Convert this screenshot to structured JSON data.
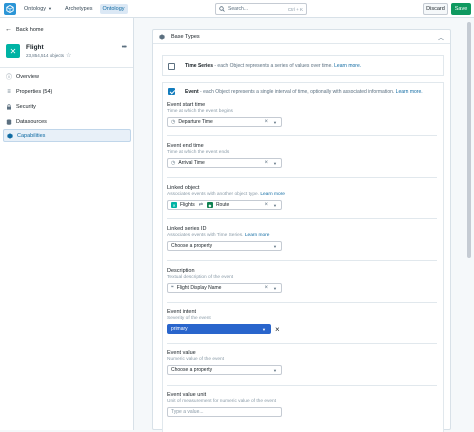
{
  "topbar": {
    "app_label": "Ontology",
    "tabs": [
      "Archetypes",
      "Ontology"
    ],
    "search_placeholder": "Search...",
    "search_shortcut": "Ctrl + K",
    "discard_label": "Discard",
    "save_label": "Save"
  },
  "sidebar": {
    "back_label": "Back home",
    "object_name": "Flight",
    "object_count": "23,854,514 objects",
    "items": [
      {
        "label": "Overview",
        "icon": "info-icon"
      },
      {
        "label": "Properties (54)",
        "icon": "properties-icon"
      },
      {
        "label": "Security",
        "icon": "lock-icon"
      },
      {
        "label": "Datasources",
        "icon": "database-icon"
      },
      {
        "label": "Capabilities",
        "icon": "cube-icon"
      }
    ]
  },
  "section": {
    "title": "Base Types"
  },
  "timeseries": {
    "name": "Time Series",
    "desc": " - each Object represents a series of values over time.",
    "link": "Learn more."
  },
  "event": {
    "name": "Event",
    "desc": " - each Object represents a single interval of time, optionally with associated information.",
    "link": "Learn more."
  },
  "fields": {
    "start": {
      "label": "Event start time",
      "desc": "Time at which the event begins",
      "value": "Departure Time"
    },
    "end": {
      "label": "Event end time",
      "desc": "Time at which the event ends",
      "value": "Arrival Time"
    },
    "linked": {
      "label": "Linked object",
      "desc": "Associates events with another object type.",
      "link": "Learn more",
      "from": "Flights",
      "to": "Route"
    },
    "series": {
      "label": "Linked series ID",
      "desc": "Associates events with Time Series.",
      "link": "Learn more",
      "value": "Choose a property"
    },
    "description": {
      "label": "Description",
      "desc": "Textual description of the event",
      "value": "Flight Display Name"
    },
    "intent": {
      "label": "Event intent",
      "desc": "Severity of the event",
      "value": "primary"
    },
    "value": {
      "label": "Event value",
      "desc": "Numeric value of the event",
      "value": "Choose a property"
    },
    "unit": {
      "label": "Event value unit",
      "desc": "Unit of measurement for numeric value of the event",
      "placeholder": "Type a value..."
    }
  },
  "colors": {
    "accent": "#137cbd",
    "save": "#0f9960",
    "object": "#00b3a4",
    "intent": "#2965cc"
  }
}
